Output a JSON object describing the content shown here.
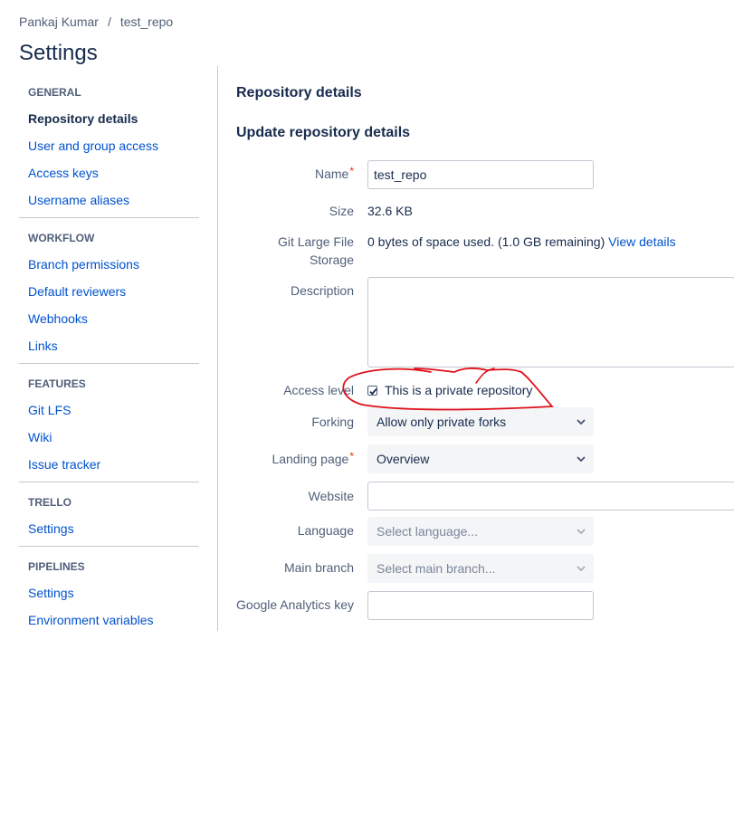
{
  "breadcrumb": {
    "owner": "Pankaj Kumar",
    "separator": "/",
    "repo": "test_repo"
  },
  "page": {
    "title": "Settings"
  },
  "sidebar": {
    "sections": [
      {
        "heading": "GENERAL",
        "items": [
          "Repository details",
          "User and group access",
          "Access keys",
          "Username aliases"
        ],
        "active": 0
      },
      {
        "heading": "WORKFLOW",
        "items": [
          "Branch permissions",
          "Default reviewers",
          "Webhooks",
          "Links"
        ]
      },
      {
        "heading": "FEATURES",
        "items": [
          "Git LFS",
          "Wiki",
          "Issue tracker"
        ]
      },
      {
        "heading": "TRELLO",
        "items": [
          "Settings"
        ]
      },
      {
        "heading": "PIPELINES",
        "items": [
          "Settings",
          "Environment variables"
        ]
      }
    ]
  },
  "main": {
    "section_title": "Repository details",
    "form_title": "Update repository details",
    "required_marker": "*",
    "name": {
      "label": "Name",
      "value": "test_repo"
    },
    "size": {
      "label": "Size",
      "value": "32.6 KB"
    },
    "lfs": {
      "label_line1": "Git Large File",
      "label_line2": "Storage",
      "value": "0 bytes of space used. (1.0 GB remaining)",
      "link": "View details"
    },
    "description": {
      "label": "Description",
      "value": ""
    },
    "access_level": {
      "label": "Access level",
      "checkbox_label": "This is a private repository",
      "checked": true
    },
    "forking": {
      "label": "Forking",
      "value": "Allow only private forks"
    },
    "landing_page": {
      "label": "Landing page",
      "value": "Overview"
    },
    "website": {
      "label": "Website",
      "value": ""
    },
    "language": {
      "label": "Language",
      "placeholder": "Select language..."
    },
    "main_branch": {
      "label": "Main branch",
      "placeholder": "Select main branch..."
    },
    "google_analytics": {
      "label": "Google Analytics key",
      "value": ""
    }
  },
  "colors": {
    "link": "#0052cc",
    "text": "#172b4d",
    "muted": "#505f79",
    "required": "#de350b",
    "annotation": "#e0101a"
  }
}
